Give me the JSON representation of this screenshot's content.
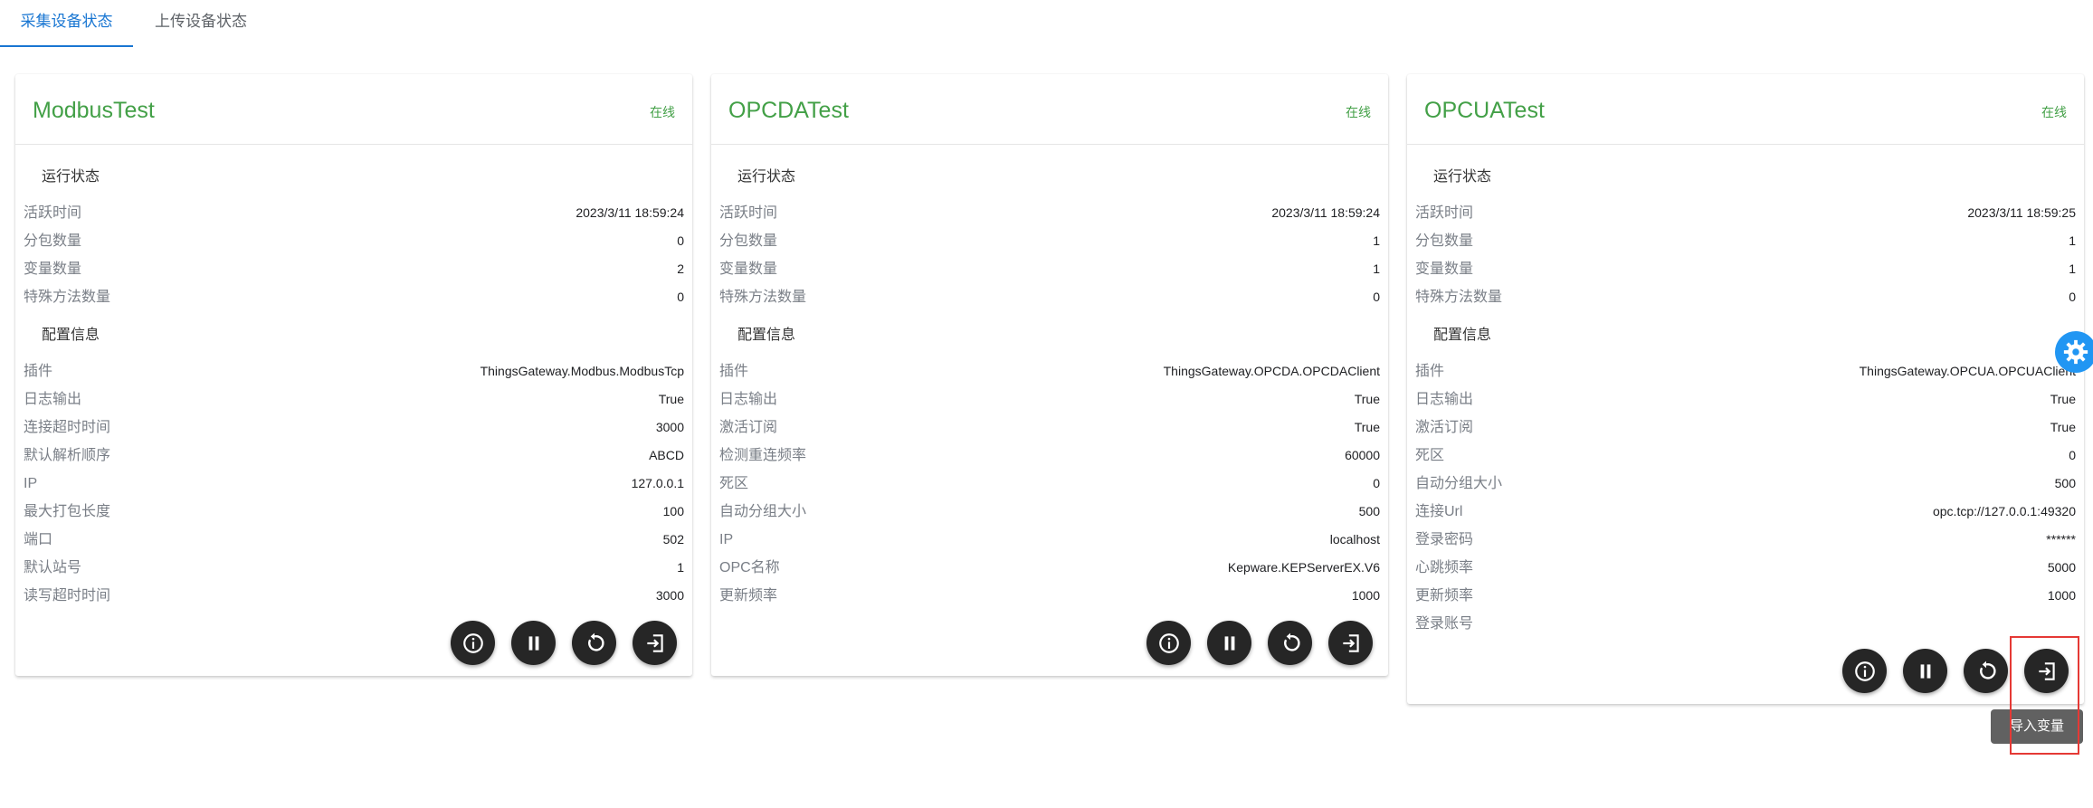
{
  "tabs": [
    {
      "label": "采集设备状态",
      "active": true
    },
    {
      "label": "上传设备状态",
      "active": false
    }
  ],
  "cards": [
    {
      "name": "ModbusTest",
      "status": "在线",
      "section1": "运行状态",
      "run": [
        {
          "label": "活跃时间",
          "value": "2023/3/11 18:59:24"
        },
        {
          "label": "分包数量",
          "value": "0"
        },
        {
          "label": "变量数量",
          "value": "2"
        },
        {
          "label": "特殊方法数量",
          "value": "0"
        }
      ],
      "section2": "配置信息",
      "config": [
        {
          "label": "插件",
          "value": "ThingsGateway.Modbus.ModbusTcp"
        },
        {
          "label": "日志输出",
          "value": "True"
        },
        {
          "label": "连接超时时间",
          "value": "3000"
        },
        {
          "label": "默认解析顺序",
          "value": "ABCD"
        },
        {
          "label": "IP",
          "value": "127.0.0.1"
        },
        {
          "label": "最大打包长度",
          "value": "100"
        },
        {
          "label": "端口",
          "value": "502"
        },
        {
          "label": "默认站号",
          "value": "1"
        },
        {
          "label": "读写超时时间",
          "value": "3000"
        }
      ]
    },
    {
      "name": "OPCDATest",
      "status": "在线",
      "section1": "运行状态",
      "run": [
        {
          "label": "活跃时间",
          "value": "2023/3/11 18:59:24"
        },
        {
          "label": "分包数量",
          "value": "1"
        },
        {
          "label": "变量数量",
          "value": "1"
        },
        {
          "label": "特殊方法数量",
          "value": "0"
        }
      ],
      "section2": "配置信息",
      "config": [
        {
          "label": "插件",
          "value": "ThingsGateway.OPCDA.OPCDAClient"
        },
        {
          "label": "日志输出",
          "value": "True"
        },
        {
          "label": "激活订阅",
          "value": "True"
        },
        {
          "label": "检测重连频率",
          "value": "60000"
        },
        {
          "label": "死区",
          "value": "0"
        },
        {
          "label": "自动分组大小",
          "value": "500"
        },
        {
          "label": "IP",
          "value": "localhost"
        },
        {
          "label": "OPC名称",
          "value": "Kepware.KEPServerEX.V6"
        },
        {
          "label": "更新频率",
          "value": "1000"
        }
      ]
    },
    {
      "name": "OPCUATest",
      "status": "在线",
      "section1": "运行状态",
      "run": [
        {
          "label": "活跃时间",
          "value": "2023/3/11 18:59:25"
        },
        {
          "label": "分包数量",
          "value": "1"
        },
        {
          "label": "变量数量",
          "value": "1"
        },
        {
          "label": "特殊方法数量",
          "value": "0"
        }
      ],
      "section2": "配置信息",
      "config": [
        {
          "label": "插件",
          "value": "ThingsGateway.OPCUA.OPCUAClient"
        },
        {
          "label": "日志输出",
          "value": "True"
        },
        {
          "label": "激活订阅",
          "value": "True"
        },
        {
          "label": "死区",
          "value": "0"
        },
        {
          "label": "自动分组大小",
          "value": "500"
        },
        {
          "label": "连接Url",
          "value": "opc.tcp://127.0.0.1:49320"
        },
        {
          "label": "登录密码",
          "value": "******"
        },
        {
          "label": "心跳频率",
          "value": "5000"
        },
        {
          "label": "更新频率",
          "value": "1000"
        },
        {
          "label": "登录账号",
          "value": ""
        }
      ]
    }
  ],
  "actions": [
    {
      "icon": "info-icon"
    },
    {
      "icon": "pause-icon"
    },
    {
      "icon": "restart-icon"
    },
    {
      "icon": "import-icon"
    }
  ],
  "tooltip": "导入变量",
  "colors": {
    "accent": "#1976d2",
    "online": "#43a047",
    "button": "#262626",
    "fab": "#2196f3",
    "highlight": "#e53935"
  }
}
